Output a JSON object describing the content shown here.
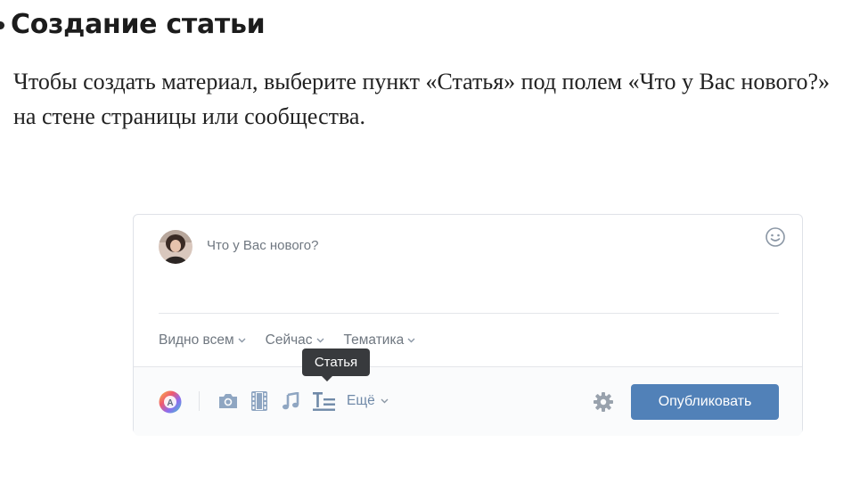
{
  "article": {
    "heading": "Создание статьи",
    "paragraph": "Чтобы создать материал, выберите пункт «Статья» под полем «Что у Вас нового?» на стене страницы или сообщества."
  },
  "post_form": {
    "placeholder": "Что у Вас нового?",
    "dropdowns": [
      {
        "label": "Видно всем"
      },
      {
        "label": "Сейчас"
      },
      {
        "label": "Тематика"
      }
    ],
    "attach_icons": [
      "color-theme-icon",
      "camera-icon",
      "video-icon",
      "music-icon",
      "article-icon"
    ],
    "more_label": "Ещё",
    "publish_label": "Опубликовать",
    "tooltip": "Статья"
  },
  "colors": {
    "accent": "#5181b8",
    "icon": "#8fa6c2",
    "tooltip_bg": "#383a3d"
  }
}
